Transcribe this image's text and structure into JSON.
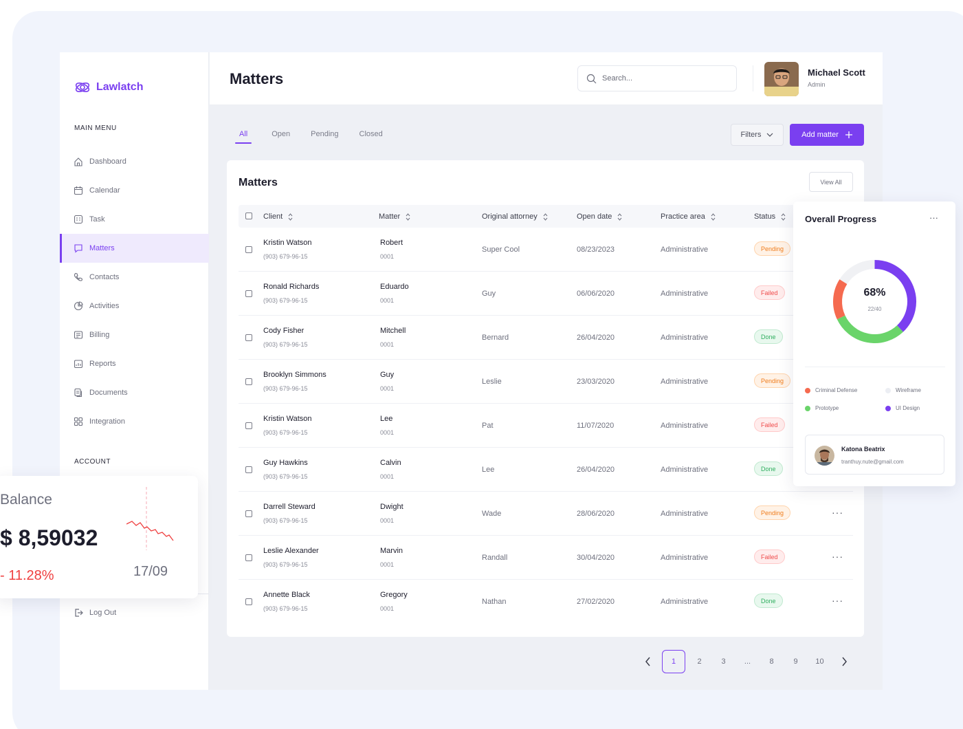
{
  "app": {
    "name": "Lawlatch"
  },
  "sidebar": {
    "main_menu_label": "MAIN MENU",
    "account_label": "ACCOUNT",
    "items": [
      {
        "label": "Dashboard",
        "icon": "home-icon",
        "name": "dashboard"
      },
      {
        "label": "Calendar",
        "icon": "calendar-icon",
        "name": "calendar"
      },
      {
        "label": "Task",
        "icon": "task-icon",
        "name": "task"
      },
      {
        "label": "Matters",
        "icon": "chat-icon",
        "name": "matters",
        "active": true
      },
      {
        "label": "Contacts",
        "icon": "phone-icon",
        "name": "contacts"
      },
      {
        "label": "Activities",
        "icon": "pie-icon",
        "name": "activities"
      },
      {
        "label": "Billing",
        "icon": "billing-icon",
        "name": "billing"
      },
      {
        "label": "Reports",
        "icon": "reports-icon",
        "name": "reports"
      },
      {
        "label": "Documents",
        "icon": "documents-icon",
        "name": "documents"
      },
      {
        "label": "Integration",
        "icon": "grid-icon",
        "name": "integration"
      }
    ],
    "logout_label": "Log Out"
  },
  "header": {
    "title": "Matters",
    "search_placeholder": "Search...",
    "user_name": "Michael Scott",
    "user_role": "Admin"
  },
  "tabs": [
    "All",
    "Open",
    "Pending",
    "Closed"
  ],
  "toolbar": {
    "filters_label": "Filters",
    "add_label": "Add matter"
  },
  "table": {
    "title": "Matters",
    "view_all_label": "View All",
    "columns": [
      "Client",
      "Matter",
      "Original attorney",
      "Open date",
      "Practice area",
      "Status"
    ],
    "rows": [
      {
        "client": "Kristin Watson",
        "phone": "(903) 679-96-15",
        "matter": "Robert",
        "matter_no": "0001",
        "attorney": "Super Cool",
        "date": "08/23/2023",
        "area": "Administrative",
        "status": "Pending",
        "status_kind": "pending"
      },
      {
        "client": "Ronald Richards",
        "phone": "(903) 679-96-15",
        "matter": "Eduardo",
        "matter_no": "0001",
        "attorney": "Guy",
        "date": "06/06/2020",
        "area": "Administrative",
        "status": "Failed",
        "status_kind": "failed"
      },
      {
        "client": "Cody Fisher",
        "phone": "(903) 679-96-15",
        "matter": "Mitchell",
        "matter_no": "0001",
        "attorney": "Bernard",
        "date": "26/04/2020",
        "area": "Administrative",
        "status": "Done",
        "status_kind": "done"
      },
      {
        "client": "Brooklyn Simmons",
        "phone": "(903) 679-96-15",
        "matter": "Guy",
        "matter_no": "0001",
        "attorney": "Leslie",
        "date": "23/03/2020",
        "area": "Administrative",
        "status": "Pending",
        "status_kind": "pending"
      },
      {
        "client": "Kristin Watson",
        "phone": "(903) 679-96-15",
        "matter": "Lee",
        "matter_no": "0001",
        "attorney": "Pat",
        "date": "11/07/2020",
        "area": "Administrative",
        "status": "Failed",
        "status_kind": "failed"
      },
      {
        "client": "Guy Hawkins",
        "phone": "(903) 679-96-15",
        "matter": "Calvin",
        "matter_no": "0001",
        "attorney": "Lee",
        "date": "26/04/2020",
        "area": "Administrative",
        "status": "Done",
        "status_kind": "done"
      },
      {
        "client": "Darrell Steward",
        "phone": "(903) 679-96-15",
        "matter": "Dwight",
        "matter_no": "0001",
        "attorney": "Wade",
        "date": "28/06/2020",
        "area": "Administrative",
        "status": "Pending",
        "status_kind": "pending"
      },
      {
        "client": "Leslie Alexander",
        "phone": "(903) 679-96-15",
        "matter": "Marvin",
        "matter_no": "0001",
        "attorney": "Randall",
        "date": "30/04/2020",
        "area": "Administrative",
        "status": "Failed",
        "status_kind": "failed"
      },
      {
        "client": "Annette Black",
        "phone": "(903) 679-96-15",
        "matter": "Gregory",
        "matter_no": "0001",
        "attorney": "Nathan",
        "date": "27/02/2020",
        "area": "Administrative",
        "status": "Done",
        "status_kind": "done"
      }
    ]
  },
  "pagination": {
    "pages": [
      "1",
      "2",
      "3",
      "...",
      "8",
      "9",
      "10"
    ],
    "current": "1"
  },
  "progress": {
    "title": "Overall Progress",
    "percent_label": "68%",
    "count_label": "22/40",
    "segments": [
      {
        "name": "UI Design",
        "color": "#7a3ff0",
        "share": 0.38
      },
      {
        "name": "Prototype",
        "color": "#6ad46a",
        "share": 0.3
      },
      {
        "name": "Criminal Defense",
        "color": "#f56a4f",
        "share": 0.16
      },
      {
        "name": "Wireframe",
        "color": "#f0f1f4",
        "share": 0.16
      }
    ],
    "legend": [
      {
        "label": "Criminal Defense",
        "color": "#f56a4f"
      },
      {
        "label": "Wireframe",
        "color": "#eceef3"
      },
      {
        "label": "Prototype",
        "color": "#6ad46a"
      },
      {
        "label": "UI Design",
        "color": "#7a3ff0"
      }
    ],
    "contact_name": "Katona Beatrix",
    "contact_email": "tranthuy.nute@gmail.com"
  },
  "balance": {
    "label": "Balance",
    "value": "$ 8,59032",
    "change": "- 11.28%",
    "date": "17/09"
  },
  "colors": {
    "accent": "#7a3ff0",
    "danger": "#ef3f3f",
    "success": "#2fae5f",
    "warning": "#f07d1c"
  }
}
